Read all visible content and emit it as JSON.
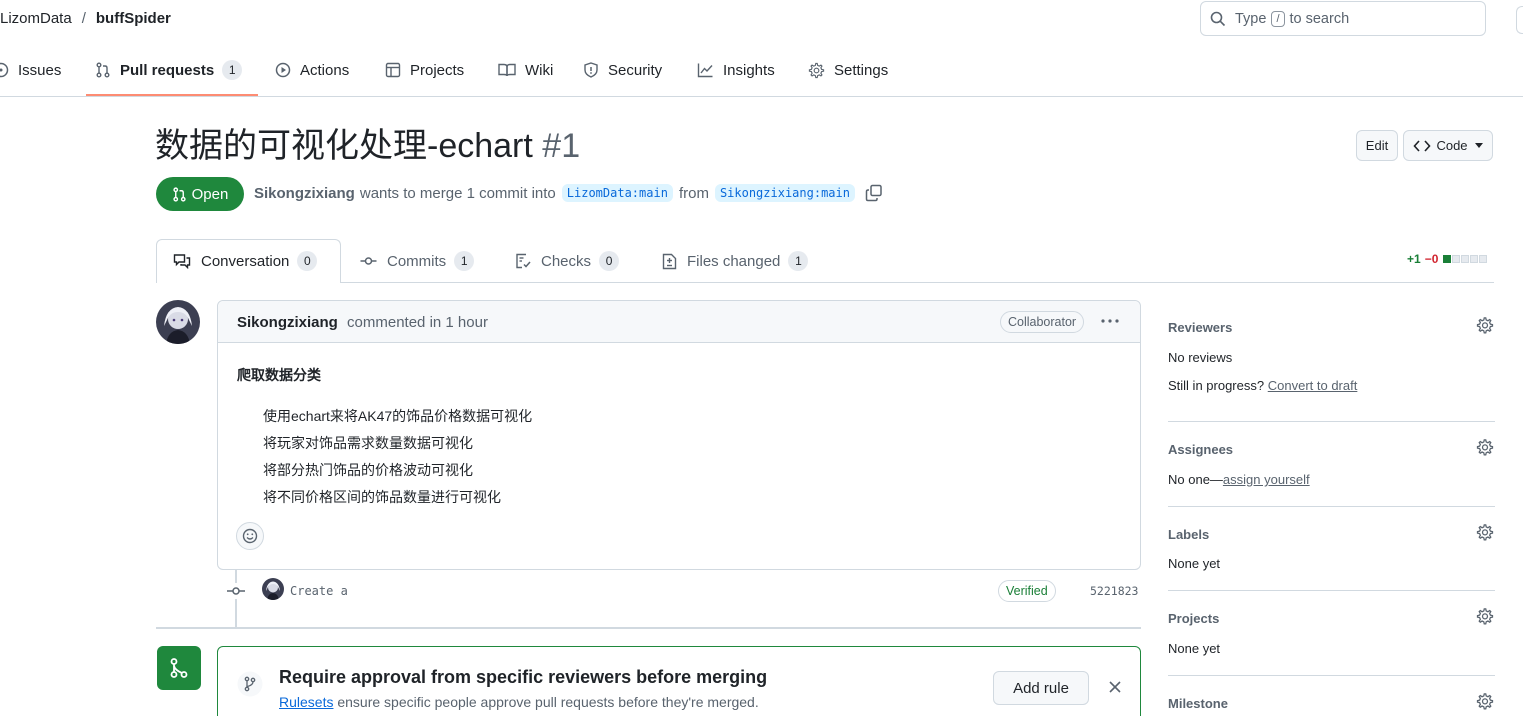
{
  "header": {
    "owner": "LizomData",
    "separator": "/",
    "repo": "buffSpider",
    "search": {
      "prefix": "Type",
      "key": "/",
      "suffix": "to search"
    }
  },
  "nav": {
    "issues": "Issues",
    "pull_requests": "Pull requests",
    "pull_requests_count": "1",
    "actions": "Actions",
    "projects": "Projects",
    "wiki": "Wiki",
    "security": "Security",
    "insights": "Insights",
    "settings": "Settings"
  },
  "pr": {
    "title": "数据的可视化处理-echart",
    "number": "#1",
    "edit_label": "Edit",
    "code_label": "Code",
    "state": "Open",
    "author": "Sikongzixiang",
    "merge_text": "wants to merge 1 commit into",
    "base_branch": "LizomData:main",
    "from_text": "from",
    "head_branch": "Sikongzixiang:main"
  },
  "tabs": {
    "conversation": "Conversation",
    "conversation_count": "0",
    "commits": "Commits",
    "commits_count": "1",
    "checks": "Checks",
    "checks_count": "0",
    "files": "Files changed",
    "files_count": "1"
  },
  "diffstat": {
    "additions": "+1",
    "deletions": "−0"
  },
  "comment": {
    "author": "Sikongzixiang",
    "action": "commented in 1 hour",
    "role": "Collaborator",
    "heading": "爬取数据分类",
    "items": [
      "使用echart来将AK47的饰品价格数据可视化",
      "将玩家对饰品需求数量数据可视化",
      "将部分热门饰品的价格波动可视化",
      "将不同价格区间的饰品数量进行可视化"
    ]
  },
  "commit": {
    "message": "Create a",
    "verified": "Verified",
    "sha": "5221823"
  },
  "merge_box": {
    "title": "Require approval from specific reviewers before merging",
    "link": "Rulesets",
    "subtitle": "ensure specific people approve pull requests before they're merged.",
    "button": "Add rule"
  },
  "sidebar": {
    "reviewers": {
      "title": "Reviewers",
      "value": "No reviews",
      "progress_prefix": "Still in progress?",
      "progress_link": "Convert to draft"
    },
    "assignees": {
      "title": "Assignees",
      "prefix": "No one—",
      "link": "assign yourself"
    },
    "labels": {
      "title": "Labels",
      "value": "None yet"
    },
    "projects": {
      "title": "Projects",
      "value": "None yet"
    },
    "milestone": {
      "title": "Milestone"
    }
  },
  "colors": {
    "open_green": "#1f883d",
    "link_blue": "#0969da",
    "underline_orange": "#fd8c73",
    "border": "#d1d9e0"
  }
}
